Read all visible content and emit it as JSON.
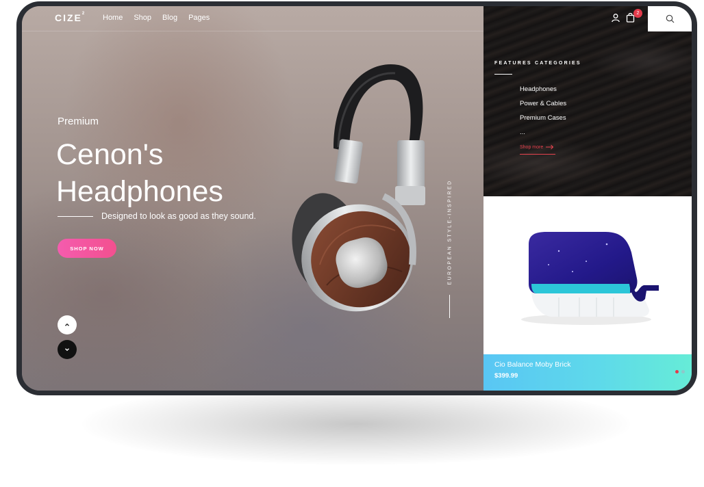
{
  "brand": {
    "name": "CIZE",
    "superscript": "2"
  },
  "nav": {
    "items": [
      "Home",
      "Shop",
      "Blog",
      "Pages"
    ]
  },
  "header": {
    "cart_count": "2"
  },
  "hero": {
    "eyebrow": "Premium",
    "title_line1": "Cenon's",
    "title_line2": "Headphones",
    "tagline": "Designed to look as good as they sound.",
    "cta": "SHOP NOW",
    "vertical_text": "EUROPEAN STYLE-INSPIRED"
  },
  "categories": {
    "title": "FEATURES CATEGORIES",
    "items": [
      "Headphones",
      "Power & Cables",
      "Premium Cases",
      "..."
    ],
    "shop_more": "Shop more"
  },
  "product": {
    "name": "Cio Balance Moby Brick",
    "price": "$399.99"
  },
  "colors": {
    "accent_pink": "#f45cae",
    "accent_red": "#e33b4b",
    "product_gradient_start": "#59c6f4",
    "product_gradient_end": "#66ecd7"
  },
  "icons": [
    "user-icon",
    "cart-icon",
    "search-icon",
    "arrow-right-icon",
    "chevron-up-icon",
    "chevron-down-icon"
  ]
}
